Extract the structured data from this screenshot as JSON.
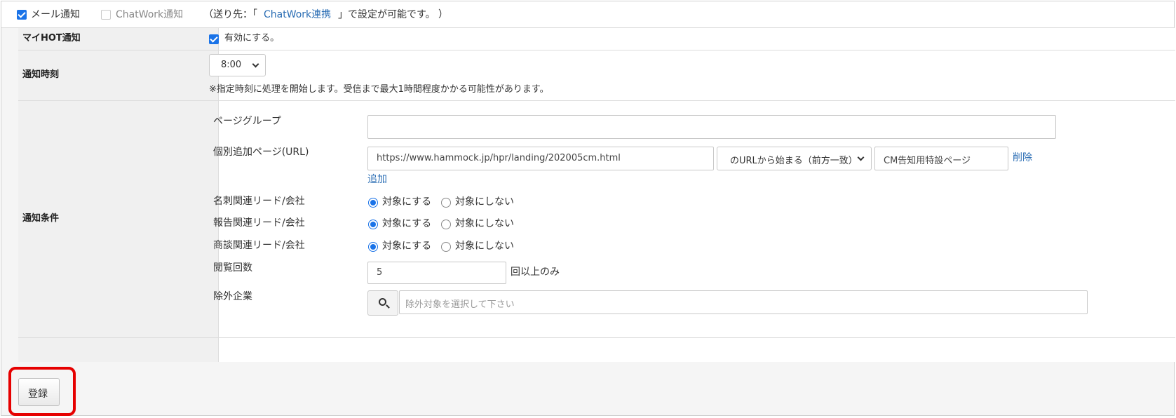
{
  "notify_channels": {
    "mail_label": "メール通知",
    "mail_checked": true,
    "chatwork_label": "ChatWork通知",
    "chatwork_checked": false,
    "dest_prefix": "（送り先：「",
    "dest_link": "ChatWork連携",
    "dest_suffix": "」で設定が可能です。 ）"
  },
  "my_hot": {
    "label": "マイHOT通知",
    "enable_label": "有効にする。",
    "enabled": true
  },
  "notify_time": {
    "label": "通知時刻",
    "value": "8:00",
    "note": "※指定時刻に処理を開始します。受信まで最大1時間程度かかる可能性があります。"
  },
  "conditions": {
    "label": "通知条件",
    "page_group_label": "ページグループ",
    "page_group_value": "",
    "individual_page_label": "個別追加ページ(URL)",
    "url_value": "https://www.hammock.jp/hpr/landing/202005cm.html",
    "match_value": "のURLから始まる（前方一致）",
    "page_name_value": "CM告知用特設ページ",
    "delete_link": "削除",
    "add_link": "追加",
    "radio_on_label": "対象にする",
    "radio_off_label": "対象にしない",
    "card_label": "名刺関連リード/会社",
    "report_label": "報告関連リード/会社",
    "deal_label": "商談関連リード/会社",
    "view_count_label": "閲覧回数",
    "view_count_value": "5",
    "view_count_suffix": "回以上のみ",
    "exclude_label": "除外企業",
    "exclude_placeholder": "除外対象を選択して下さい"
  },
  "submit_label": "登録",
  "colors": {
    "accent": "#1a73e8",
    "link": "#2a6db4",
    "highlight": "#e60000"
  }
}
